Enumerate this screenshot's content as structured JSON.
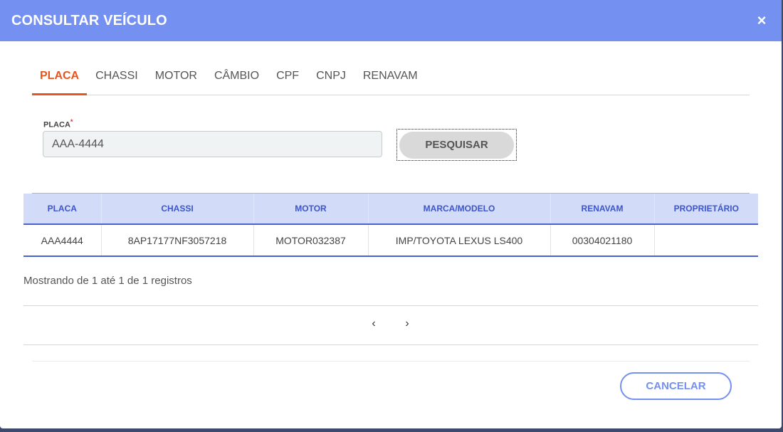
{
  "modal": {
    "title": "CONSULTAR VEÍCULO",
    "close_label": "×"
  },
  "tabs": [
    {
      "label": "PLACA",
      "active": true
    },
    {
      "label": "CHASSI",
      "active": false
    },
    {
      "label": "MOTOR",
      "active": false
    },
    {
      "label": "CÂMBIO",
      "active": false
    },
    {
      "label": "CPF",
      "active": false
    },
    {
      "label": "CNPJ",
      "active": false
    },
    {
      "label": "RENAVAM",
      "active": false
    }
  ],
  "form": {
    "field_label": "PLACA",
    "required_mark": "*",
    "placa_value": "AAA-4444",
    "search_label": "PESQUISAR"
  },
  "table": {
    "headers": [
      "PLACA",
      "CHASSI",
      "MOTOR",
      "MARCA/MODELO",
      "RENAVAM",
      "PROPRIETÁRIO"
    ],
    "rows": [
      [
        "AAA4444",
        "8AP17177NF3057218",
        "MOTOR032387",
        "IMP/TOYOTA LEXUS LS400",
        "00304021180",
        ""
      ]
    ]
  },
  "pagination": {
    "info": "Mostrando de 1 até 1 de 1 registros",
    "prev_icon": "‹",
    "next_icon": "›"
  },
  "footer": {
    "cancel_label": "CANCELAR"
  },
  "colors": {
    "header_bg": "#7490f0",
    "active_tab": "#e8541c",
    "table_header_bg": "#d2dbf8",
    "table_header_text": "#3d55c8"
  }
}
